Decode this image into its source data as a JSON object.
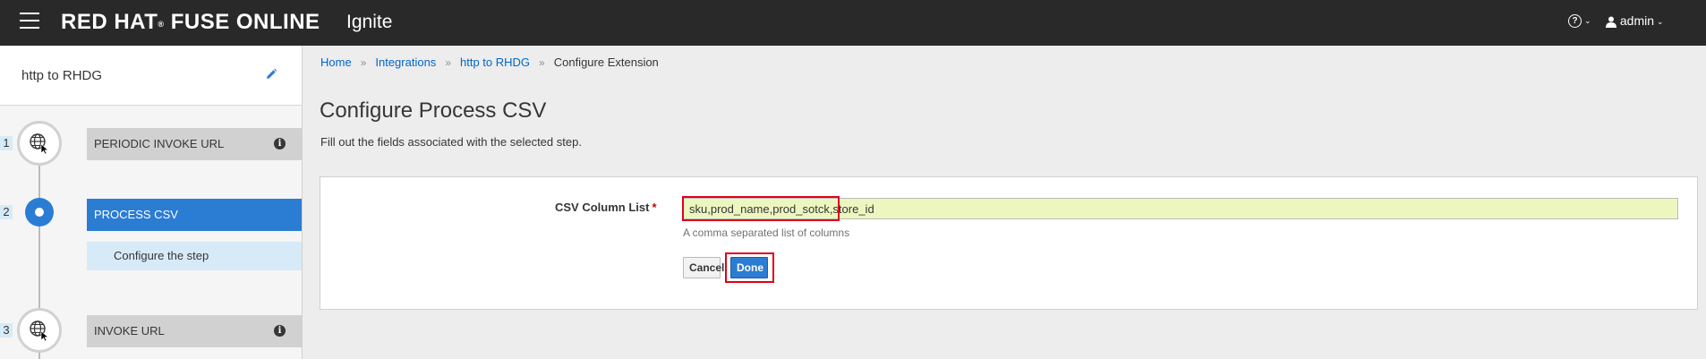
{
  "header": {
    "brand": "RED HAT",
    "brand_mark": "®",
    "brand_product": "FUSE ONLINE",
    "product": "Ignite",
    "help_icon": "help-icon",
    "user_name": "admin"
  },
  "sidebar": {
    "integration_name": "http to RHDG",
    "steps": [
      {
        "number": "1",
        "label": "PERIODIC INVOKE URL",
        "icon": "globe-cursor-icon",
        "info": "i"
      },
      {
        "number": "2",
        "label": "PROCESS CSV",
        "active": true,
        "sub_label": "Configure the step"
      },
      {
        "number": "3",
        "label": "INVOKE URL",
        "icon": "globe-cursor-icon",
        "info": "i"
      }
    ]
  },
  "breadcrumb": {
    "items": [
      "Home",
      "Integrations",
      "http to RHDG",
      "Configure Extension"
    ],
    "separator": "»"
  },
  "main": {
    "title": "Configure Process CSV",
    "description": "Fill out the fields associated with the selected step.",
    "field": {
      "label": "CSV Column List",
      "required_mark": "*",
      "value": "sku,prod_name,prod_sotck,store_id",
      "help": "A comma separated list of columns"
    },
    "cancel_label": "Cancel",
    "done_label": "Done"
  },
  "colors": {
    "accent": "#2b7cd3",
    "highlight": "#e0001b",
    "input_bg": "#eef6c0"
  }
}
